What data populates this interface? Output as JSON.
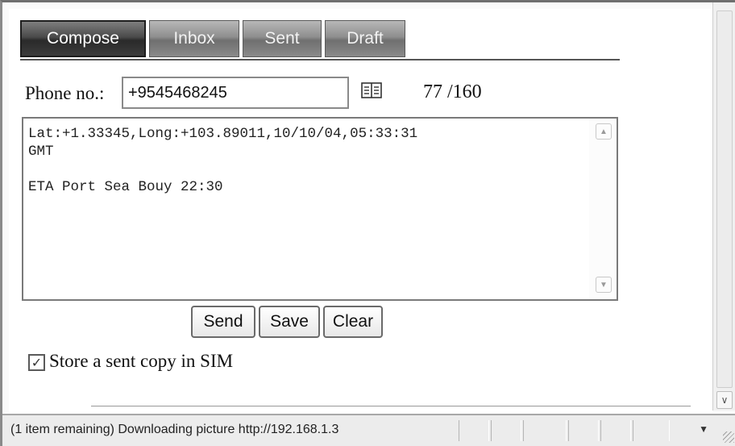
{
  "tabs": [
    {
      "label": "Compose",
      "active": true
    },
    {
      "label": "Inbox",
      "active": false
    },
    {
      "label": "Sent",
      "active": false
    },
    {
      "label": "Draft",
      "active": false
    }
  ],
  "phone": {
    "label": "Phone no.:",
    "value": "+9545468245",
    "address_book_icon": "address-book-icon"
  },
  "char_count": "77 /160",
  "message": "Lat:+1.33345,Long:+103.89011,10/10/04,05:33:31\nGMT\n\nETA Port Sea Bouy 22:30",
  "buttons": {
    "send": "Send",
    "save": "Save",
    "clear": "Clear"
  },
  "store_copy": {
    "checked": true,
    "label": "Store a sent copy in SIM"
  },
  "statusbar": {
    "text": "(1 item remaining) Downloading picture http://192.168.1.3"
  }
}
